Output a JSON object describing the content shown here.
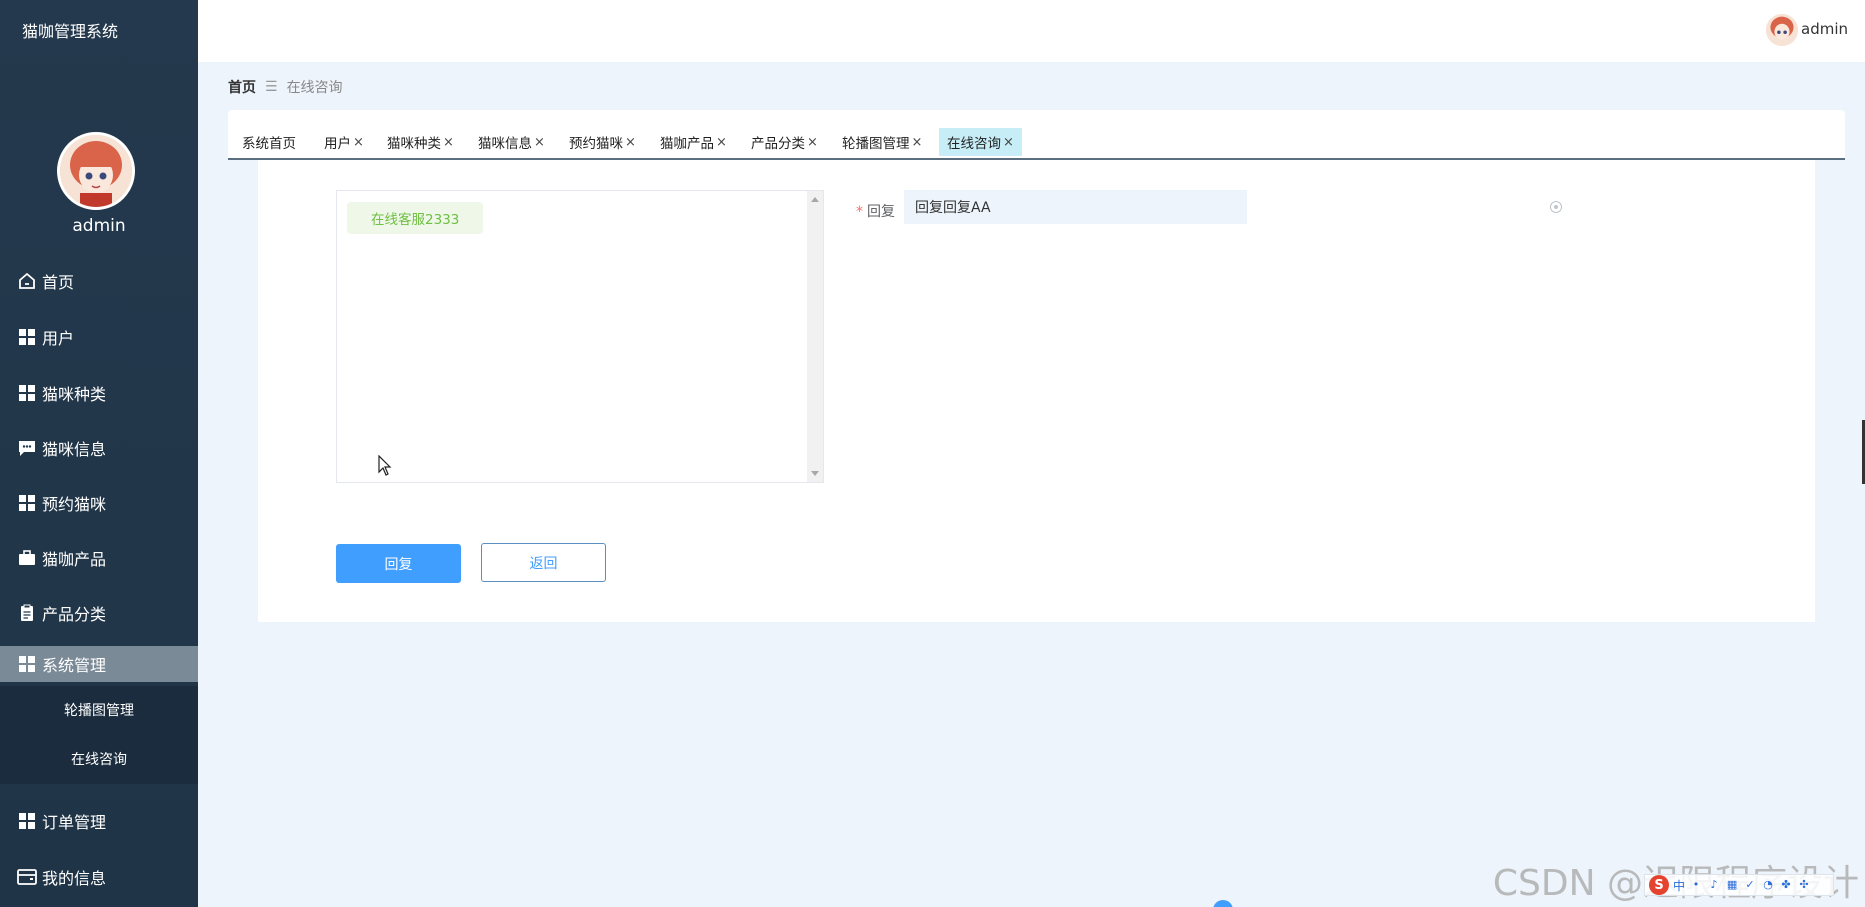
{
  "app": {
    "title": "猫咖管理系统"
  },
  "user": {
    "name": "admin"
  },
  "sidebar": {
    "items": [
      {
        "label": "首页",
        "icon": "home-icon"
      },
      {
        "label": "用户",
        "icon": "grid-icon"
      },
      {
        "label": "猫咪种类",
        "icon": "grid-icon"
      },
      {
        "label": "猫咪信息",
        "icon": "chat-icon"
      },
      {
        "label": "预约猫咪",
        "icon": "grid-icon"
      },
      {
        "label": "猫咖产品",
        "icon": "briefcase-icon"
      },
      {
        "label": "产品分类",
        "icon": "clipboard-icon"
      },
      {
        "label": "系统管理",
        "icon": "grid-icon"
      },
      {
        "label": "订单管理",
        "icon": "grid-icon"
      },
      {
        "label": "我的信息",
        "icon": "wallet-icon"
      }
    ],
    "submenu": [
      {
        "label": "轮播图管理"
      },
      {
        "label": "在线咨询"
      }
    ]
  },
  "breadcrumb": {
    "home": "首页",
    "separator": "☰",
    "current": "在线咨询"
  },
  "tabs": [
    {
      "label": "系统首页"
    },
    {
      "label": "用户"
    },
    {
      "label": "猫咪种类"
    },
    {
      "label": "猫咪信息"
    },
    {
      "label": "预约猫咪"
    },
    {
      "label": "猫咖产品"
    },
    {
      "label": "产品分类"
    },
    {
      "label": "轮播图管理"
    },
    {
      "label": "在线咨询"
    }
  ],
  "tab_close_glyph": "×",
  "chat": {
    "message": "在线客服2333"
  },
  "form": {
    "required_mark": "*",
    "reply_label": "回复",
    "reply_value": "回复回复AA"
  },
  "buttons": {
    "reply": "回复",
    "back": "返回"
  },
  "watermark": "CSDN @迟限程序设计",
  "ime": {
    "logo": "S",
    "lang": "中"
  },
  "colors": {
    "primary": "#409eff",
    "sidebar": "#24394d",
    "active_tab": "#c7edf6",
    "chat_bubble": "#eef7e8"
  }
}
